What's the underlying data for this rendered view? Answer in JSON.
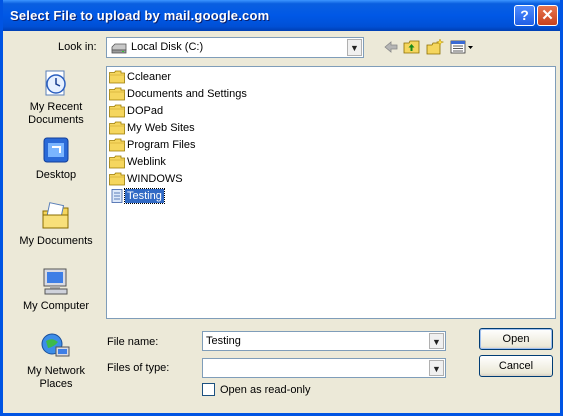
{
  "window": {
    "title": "Select File to upload by mail.google.com",
    "help_glyph": "?",
    "close_glyph": "✕"
  },
  "toolbar": {
    "look_in_label": "Look in:",
    "look_in_value": "Local Disk (C:)",
    "icons": [
      "back-arrow-icon",
      "up-one-level-icon",
      "create-new-folder-icon",
      "view-menu-icon"
    ]
  },
  "places": [
    {
      "label": "My Recent Documents",
      "icon": "recent-documents-icon"
    },
    {
      "label": "Desktop",
      "icon": "desktop-icon"
    },
    {
      "label": "My Documents",
      "icon": "my-documents-icon"
    },
    {
      "label": "My Computer",
      "icon": "my-computer-icon"
    },
    {
      "label": "My Network Places",
      "icon": "network-places-icon"
    }
  ],
  "files": [
    {
      "name": "Ccleaner",
      "type": "folder"
    },
    {
      "name": "Documents and Settings",
      "type": "folder"
    },
    {
      "name": "DOPad",
      "type": "folder"
    },
    {
      "name": "My Web Sites",
      "type": "folder"
    },
    {
      "name": "Program Files",
      "type": "folder"
    },
    {
      "name": "Weblink",
      "type": "folder"
    },
    {
      "name": "WINDOWS",
      "type": "folder"
    },
    {
      "name": "Testing",
      "type": "file",
      "selected": true
    }
  ],
  "form": {
    "file_name_label": "File name:",
    "file_name_value": "Testing",
    "files_of_type_label": "Files of type:",
    "files_of_type_value": "",
    "readonly_label": "Open as read-only",
    "open_label": "Open",
    "cancel_label": "Cancel"
  },
  "colors": {
    "title_bar": "#0058e6",
    "selection": "#316ac5",
    "dialog_bg": "#ece9d8"
  }
}
